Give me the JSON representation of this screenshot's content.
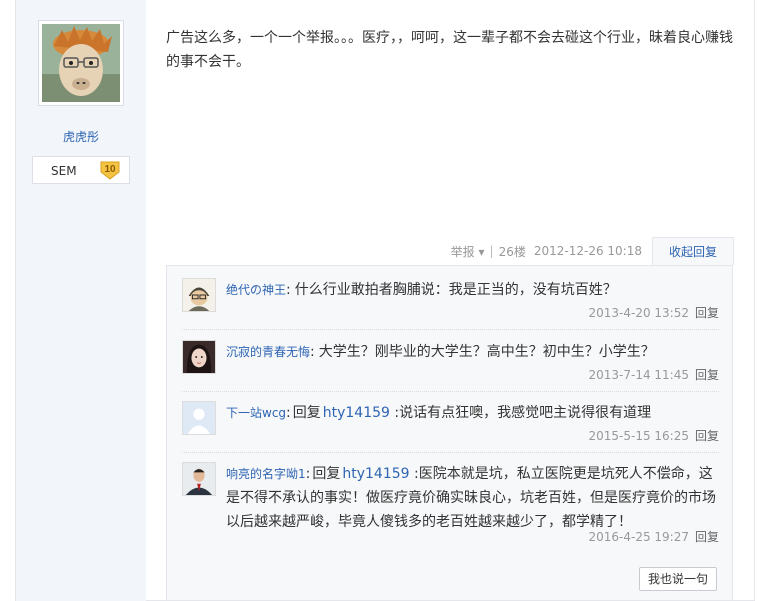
{
  "author": {
    "name": "虎虎彤",
    "level_name": "SEM",
    "level": "10"
  },
  "post": {
    "content": "广告这么多，一个一个举报。。。医疗，，呵呵，这一辈子都不会去碰这个行业，昧着良心赚钱的事不会干。",
    "report_label": "举报",
    "floor": "26楼",
    "time": "2012-12-26 10:18",
    "collapse_label": "收起回复"
  },
  "replies": [
    {
      "user": "绝代の神王",
      "reply_word": "",
      "reply_target": "",
      "text": "什么行业敢拍者胸脯说：我是正当的，没有坑百姓？",
      "time": "2013-4-20 13:52",
      "reply_label": "回复"
    },
    {
      "user": "沉寂的青春无悔",
      "reply_word": "",
      "reply_target": "",
      "text": "大学生？刚毕业的大学生？高中生？初中生？小学生？",
      "time": "2013-7-14 11:45",
      "reply_label": "回复"
    },
    {
      "user": "下一站wcg",
      "reply_word": "回复",
      "reply_target": "hty14159",
      "text": "说话有点狂噢，我感觉吧主说得很有道理",
      "time": "2015-5-15 16:25",
      "reply_label": "回复"
    },
    {
      "user": "响亮的名字呦1",
      "reply_word": "回复",
      "reply_target": "hty14159",
      "text": "医院本就是坑，私立医院更是坑死人不偿命，这是不得不承认的事实！做医疗竟价确实昧良心，坑老百姓，但是医疗竟价的市场以后越来越严峻，毕竟人傻钱多的老百姓越来越少了，都学精了！",
      "time": "2016-4-25 19:27",
      "reply_label": "回复"
    }
  ],
  "say_label": "我也说一句",
  "icons": {
    "author_avatar": "alpaca-avatar-icon",
    "level_badge": "level-badge-icon",
    "reply_avatars": [
      "cartoon-avatar-icon",
      "girl-avatar-icon",
      "default-avatar-icon",
      "man-avatar-icon"
    ]
  },
  "colors": {
    "link": "#2d64b3",
    "badge": "#f5c342",
    "sidebar_bg": "#f2f5fa",
    "reply_bg": "#f7f8fa"
  }
}
